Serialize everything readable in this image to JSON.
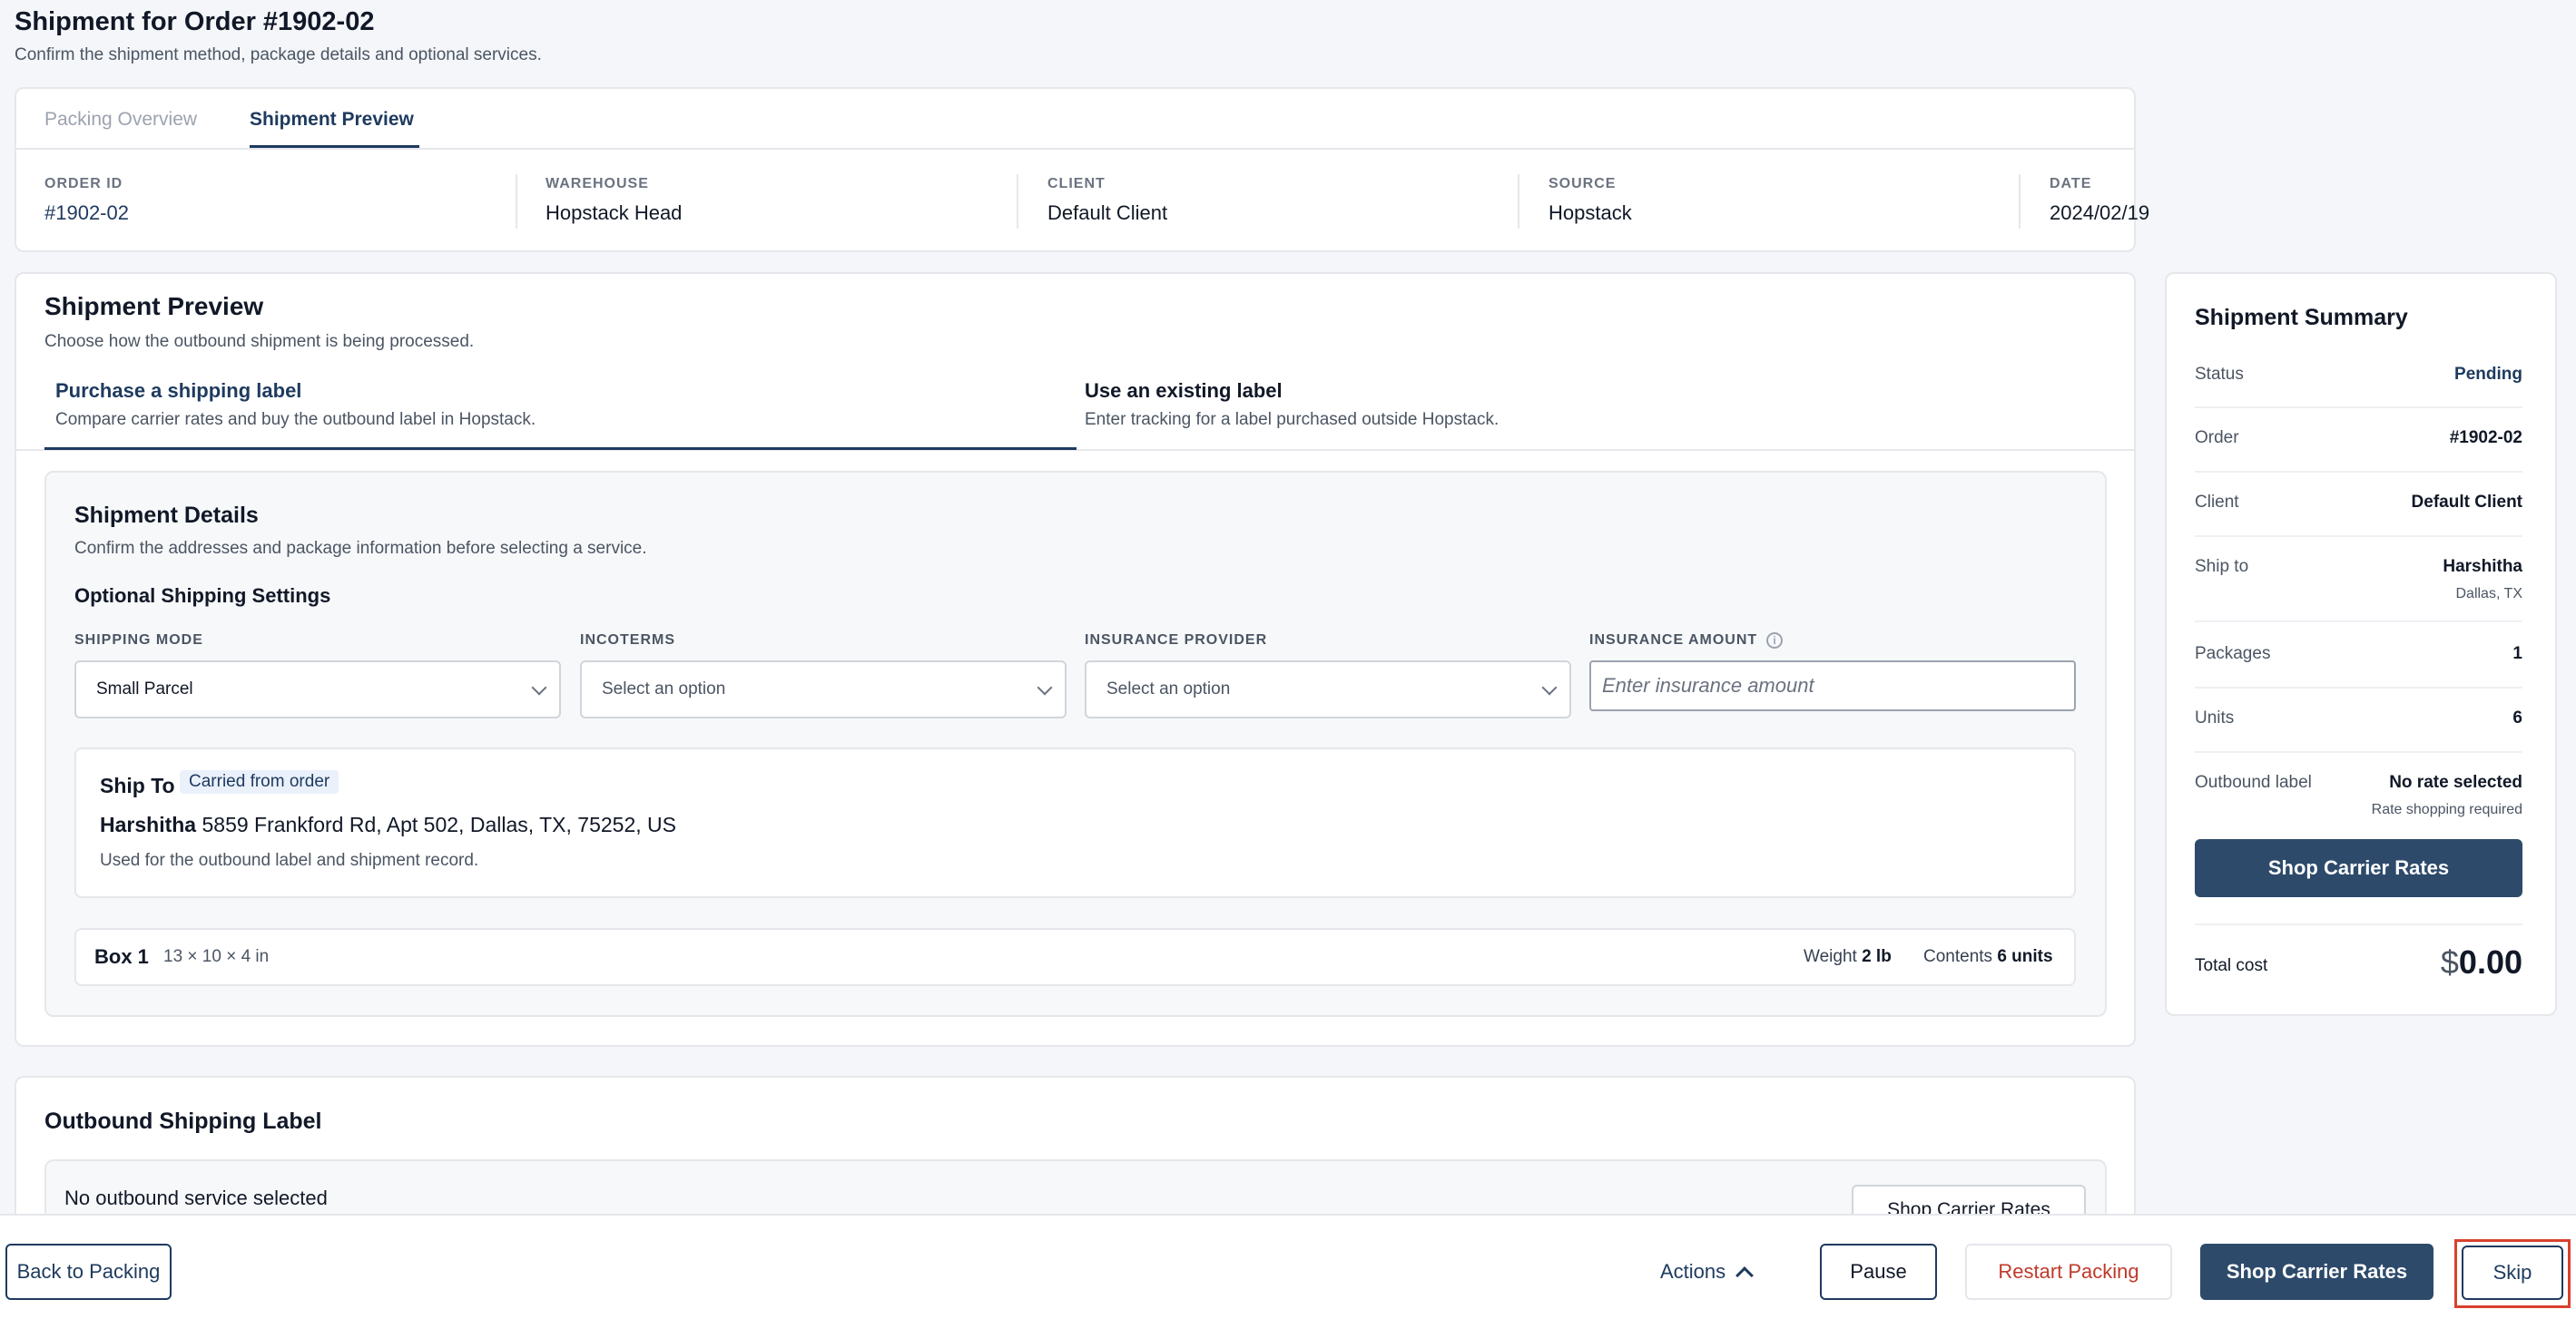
{
  "header": {
    "title": "Shipment for Order #1902-02",
    "subtitle": "Confirm the shipment method, package details and optional services."
  },
  "tabs": [
    {
      "label": "Packing Overview"
    },
    {
      "label": "Shipment Preview"
    }
  ],
  "order_meta": [
    {
      "label": "ORDER ID",
      "value": "#1902-02"
    },
    {
      "label": "WAREHOUSE",
      "value": "Hopstack Head"
    },
    {
      "label": "CLIENT",
      "value": "Default Client"
    },
    {
      "label": "SOURCE",
      "value": "Hopstack"
    },
    {
      "label": "DATE",
      "value": "2024/02/19"
    }
  ],
  "preview": {
    "title": "Shipment Preview",
    "subtitle": "Choose how the outbound shipment is being processed.",
    "methods": [
      {
        "title": "Purchase a shipping label",
        "desc": "Compare carrier rates and buy the outbound label in Hopstack."
      },
      {
        "title": "Use an existing label",
        "desc": "Enter tracking for a label purchased outside Hopstack."
      }
    ]
  },
  "details": {
    "title": "Shipment Details",
    "subtitle": "Confirm the addresses and package information before selecting a service.",
    "optional_title": "Optional Shipping Settings",
    "fields": {
      "shipping_mode": {
        "label": "SHIPPING MODE",
        "value": "Small Parcel"
      },
      "incoterms": {
        "label": "INCOTERMS",
        "value": "Select an option"
      },
      "insurance_provider": {
        "label": "INSURANCE PROVIDER",
        "value": "Select an option"
      },
      "insurance_amount": {
        "label": "INSURANCE AMOUNT",
        "placeholder": "Enter insurance amount"
      }
    },
    "ship_to": {
      "title": "Ship To",
      "badge": "Carried from order",
      "name": "Harshitha",
      "address": "5859 Frankford Rd, Apt 502, Dallas, TX, 75252, US",
      "note": "Used for the outbound label and shipment record."
    },
    "box": {
      "name": "Box 1",
      "dimensions": "13 × 10 × 4 in",
      "weight_label": "Weight",
      "weight_value": "2 lb",
      "contents_label": "Contents",
      "contents_value": "6 units"
    }
  },
  "outbound": {
    "title": "Outbound Shipping Label",
    "empty_text": "No outbound service selected",
    "button": "Shop Carrier Rates"
  },
  "summary": {
    "title": "Shipment Summary",
    "rows": [
      {
        "label": "Status",
        "value": "Pending"
      },
      {
        "label": "Order",
        "value": "#1902-02"
      },
      {
        "label": "Client",
        "value": "Default Client"
      },
      {
        "label": "Ship to",
        "value": "Harshitha",
        "sub": "Dallas, TX"
      },
      {
        "label": "Packages",
        "value": "1"
      },
      {
        "label": "Units",
        "value": "6"
      },
      {
        "label": "Outbound label",
        "value": "No rate selected",
        "sub": "Rate shopping required"
      }
    ],
    "button": "Shop Carrier Rates",
    "total_label": "Total cost",
    "total_currency": "$",
    "total_value": "0.00"
  },
  "footer": {
    "back": "Back to Packing",
    "actions": "Actions",
    "pause": "Pause",
    "restart": "Restart Packing",
    "shop": "Shop Carrier Rates",
    "skip": "Skip"
  },
  "colors": {
    "accent": "#1e3a5f",
    "primary_button": "#2d4a6b",
    "danger_text": "#c0392b",
    "highlight_outline": "#d9412e"
  }
}
